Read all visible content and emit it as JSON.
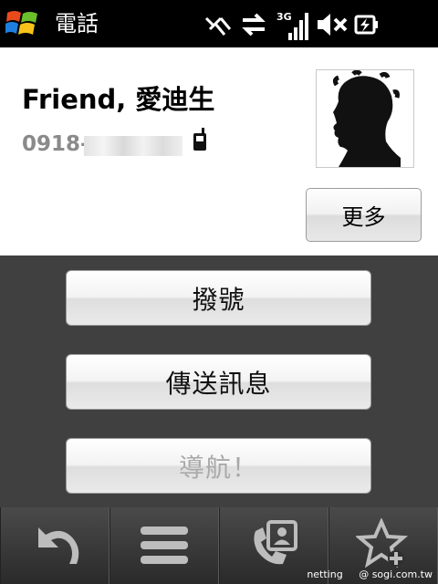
{
  "statusbar": {
    "title": "電話",
    "icons": [
      "windows-logo-icon",
      "signal-off-icon",
      "data-transfer-icon",
      "3g-icon",
      "signal-bars-icon",
      "speaker-mute-icon",
      "battery-charging-icon"
    ],
    "network_label": "3G"
  },
  "contact": {
    "name": "Friend, 愛迪生",
    "phone_prefix": "0918-",
    "phone_type_icon": "mobile-phone-icon",
    "photo_icon": "silhouette-avatar-icon",
    "more_label": "更多"
  },
  "actions": [
    {
      "label": "撥號",
      "enabled": true
    },
    {
      "label": "傳送訊息",
      "enabled": true
    },
    {
      "label": "導航！",
      "enabled": false
    }
  ],
  "toolbar": {
    "items": [
      "back-icon",
      "menu-icon",
      "contacts-call-icon",
      "add-favorite-icon"
    ]
  },
  "watermark": {
    "left": "netting",
    "right": "@ sogi.com.tw"
  },
  "colors": {
    "statusbar_bg": "#000000",
    "card_bg": "#ffffff",
    "actions_bg": "#404040",
    "disabled_text": "#a9a9a9"
  }
}
